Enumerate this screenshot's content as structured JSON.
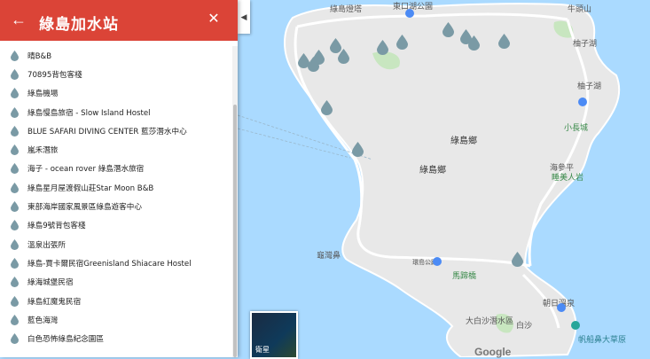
{
  "panel": {
    "title": "綠島加水站",
    "back_icon": "arrow-left-icon",
    "close_icon": "close-icon",
    "items": [
      {
        "label": "晴B&B"
      },
      {
        "label": "70895背包客棧"
      },
      {
        "label": "綠島機場"
      },
      {
        "label": "綠島慢島旅宿 - Slow Island Hostel"
      },
      {
        "label": "BLUE SAFARI DIVING CENTER 藍莎潛水中心"
      },
      {
        "label": "嵐禾潛旅"
      },
      {
        "label": "海子 - ocean rover 綠島潛水旅宿"
      },
      {
        "label": "綠島星月屋渡假山莊Star Moon B&B"
      },
      {
        "label": "東部海岸國家風景區綠島遊客中心"
      },
      {
        "label": "綠島9號背包客棧"
      },
      {
        "label": "溫泉出張所"
      },
      {
        "label": "綠島-賈卡爾民宿Greenisland Shiacare Hostel"
      },
      {
        "label": "綠海城堡民宿"
      },
      {
        "label": "綠島紅魔鬼民宿"
      },
      {
        "label": "藍色海灣"
      },
      {
        "label": "白色恐怖綠島紀念園區"
      }
    ]
  },
  "map": {
    "labels": {
      "lighthouse": "綠島燈塔",
      "east_park": "東口湖公園",
      "niutou": "牛頭山",
      "liuzi": "柚子湖",
      "liuzi_lake": "柚子湖",
      "xiaochangcheng": "小長城",
      "township1": "綠島鄉",
      "township2": "綠島鄉",
      "haishenping": "海參平",
      "suiren": "睡美人岩",
      "guiwan": "龜灣鼻",
      "road": "環島公路",
      "majing": "馬蹄橋",
      "zhaori": "朝日溫泉",
      "baisha": "大白沙潛水區",
      "baisha2": "白沙",
      "sunrise_park": "帆船鼻大草原"
    },
    "satellite_label": "衛星",
    "google_logo": "Google"
  },
  "colors": {
    "header": "#db4437",
    "water": "#aadaff",
    "land": "#e8e8e8",
    "pin": "#7a9aa5"
  }
}
